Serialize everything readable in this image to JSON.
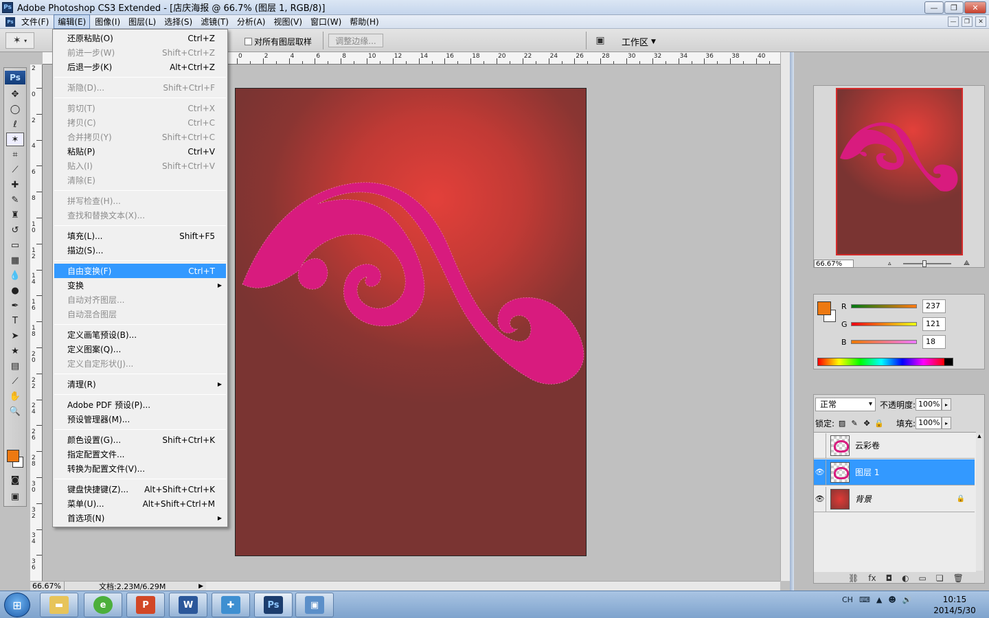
{
  "window": {
    "title": "Adobe Photoshop CS3 Extended - [店庆海报 @ 66.7% (图层 1, RGB/8)]",
    "app_icon": "Ps"
  },
  "menubar": {
    "items": [
      {
        "label": "文件(F)"
      },
      {
        "label": "编辑(E)"
      },
      {
        "label": "图像(I)"
      },
      {
        "label": "图层(L)"
      },
      {
        "label": "选择(S)"
      },
      {
        "label": "滤镜(T)"
      },
      {
        "label": "分析(A)"
      },
      {
        "label": "视图(V)"
      },
      {
        "label": "窗口(W)"
      },
      {
        "label": "帮助(H)"
      }
    ],
    "active_index": 1
  },
  "options_bar": {
    "sample_all_layers": "对所有图层取样",
    "refine_edge": "调整边缘...",
    "workspace": "工作区"
  },
  "edit_menu": {
    "items": [
      {
        "label": "还原粘贴(O)",
        "shortcut": "Ctrl+Z",
        "disabled": false
      },
      {
        "label": "前进一步(W)",
        "shortcut": "Shift+Ctrl+Z",
        "disabled": true
      },
      {
        "label": "后退一步(K)",
        "shortcut": "Alt+Ctrl+Z",
        "disabled": false
      },
      {
        "sep": true
      },
      {
        "label": "渐隐(D)...",
        "shortcut": "Shift+Ctrl+F",
        "disabled": true
      },
      {
        "sep": true
      },
      {
        "label": "剪切(T)",
        "shortcut": "Ctrl+X",
        "disabled": true
      },
      {
        "label": "拷贝(C)",
        "shortcut": "Ctrl+C",
        "disabled": true
      },
      {
        "label": "合并拷贝(Y)",
        "shortcut": "Shift+Ctrl+C",
        "disabled": true
      },
      {
        "label": "粘贴(P)",
        "shortcut": "Ctrl+V",
        "disabled": false
      },
      {
        "label": "贴入(I)",
        "shortcut": "Shift+Ctrl+V",
        "disabled": true
      },
      {
        "label": "清除(E)",
        "shortcut": "",
        "disabled": true
      },
      {
        "sep": true
      },
      {
        "label": "拼写检查(H)...",
        "shortcut": "",
        "disabled": true
      },
      {
        "label": "查找和替换文本(X)...",
        "shortcut": "",
        "disabled": true
      },
      {
        "sep": true
      },
      {
        "label": "填充(L)...",
        "shortcut": "Shift+F5",
        "disabled": false
      },
      {
        "label": "描边(S)...",
        "shortcut": "",
        "disabled": false
      },
      {
        "sep": true
      },
      {
        "label": "自由变换(F)",
        "shortcut": "Ctrl+T",
        "disabled": false,
        "highlight": true
      },
      {
        "label": "变换",
        "shortcut": "",
        "disabled": false,
        "submenu": true
      },
      {
        "label": "自动对齐图层...",
        "shortcut": "",
        "disabled": true
      },
      {
        "label": "自动混合图层",
        "shortcut": "",
        "disabled": true
      },
      {
        "sep": true
      },
      {
        "label": "定义画笔预设(B)...",
        "shortcut": "",
        "disabled": false
      },
      {
        "label": "定义图案(Q)...",
        "shortcut": "",
        "disabled": false
      },
      {
        "label": "定义自定形状(J)...",
        "shortcut": "",
        "disabled": true
      },
      {
        "sep": true
      },
      {
        "label": "清理(R)",
        "shortcut": "",
        "disabled": false,
        "submenu": true
      },
      {
        "sep": true
      },
      {
        "label": "Adobe PDF 预设(P)...",
        "shortcut": "",
        "disabled": false
      },
      {
        "label": "预设管理器(M)...",
        "shortcut": "",
        "disabled": false
      },
      {
        "sep": true
      },
      {
        "label": "颜色设置(G)...",
        "shortcut": "Shift+Ctrl+K",
        "disabled": false
      },
      {
        "label": "指定配置文件...",
        "shortcut": "",
        "disabled": false
      },
      {
        "label": "转换为配置文件(V)...",
        "shortcut": "",
        "disabled": false
      },
      {
        "sep": true
      },
      {
        "label": "键盘快捷键(Z)...",
        "shortcut": "Alt+Shift+Ctrl+K",
        "disabled": false
      },
      {
        "label": "菜单(U)...",
        "shortcut": "Alt+Shift+Ctrl+M",
        "disabled": false
      },
      {
        "label": "首选项(N)",
        "shortcut": "",
        "disabled": false,
        "submenu": true
      }
    ]
  },
  "rulers": {
    "top_labels": [
      "0",
      "2",
      "4",
      "6",
      "8",
      "10",
      "12",
      "14",
      "16",
      "18",
      "20",
      "22",
      "24",
      "26",
      "28",
      "30",
      "32",
      "34",
      "36",
      "38",
      "40"
    ],
    "left_labels": [
      "2",
      "0",
      "2",
      "4",
      "6",
      "8",
      "10",
      "12",
      "14",
      "16",
      "18",
      "20",
      "22",
      "24",
      "26",
      "28",
      "30",
      "32",
      "34",
      "36"
    ]
  },
  "status": {
    "zoom": "66.67%",
    "doc_info": "文档:2.23M/6.29M"
  },
  "navigator": {
    "zoom": "66.67%"
  },
  "color_panel": {
    "foreground": "#ed7912",
    "channels": [
      {
        "label": "R",
        "value": "237"
      },
      {
        "label": "G",
        "value": "121"
      },
      {
        "label": "B",
        "value": "18"
      }
    ]
  },
  "layers_panel": {
    "blend_mode": "正常",
    "opacity_label": "不透明度:",
    "opacity": "100%",
    "lock_label": "锁定:",
    "fill_label": "填充:",
    "fill": "100%",
    "layers": [
      {
        "name": "云彩卷",
        "visible": false,
        "selected": false
      },
      {
        "name": "图层 1",
        "visible": true,
        "selected": true
      },
      {
        "name": "背景",
        "visible": true,
        "selected": false,
        "locked": true
      }
    ]
  },
  "taskbar": {
    "apps": [
      "explorer",
      "browser-360",
      "powerpoint",
      "word",
      "toolbox",
      "photoshop",
      "image-viewer"
    ],
    "ps_label": "Ps",
    "word_label": "W",
    "tray_lang": "CH",
    "time": "10:15",
    "date": "2014/5/30"
  },
  "colors": {
    "accent": "#3399ff",
    "ornament": "#d81b7e"
  }
}
